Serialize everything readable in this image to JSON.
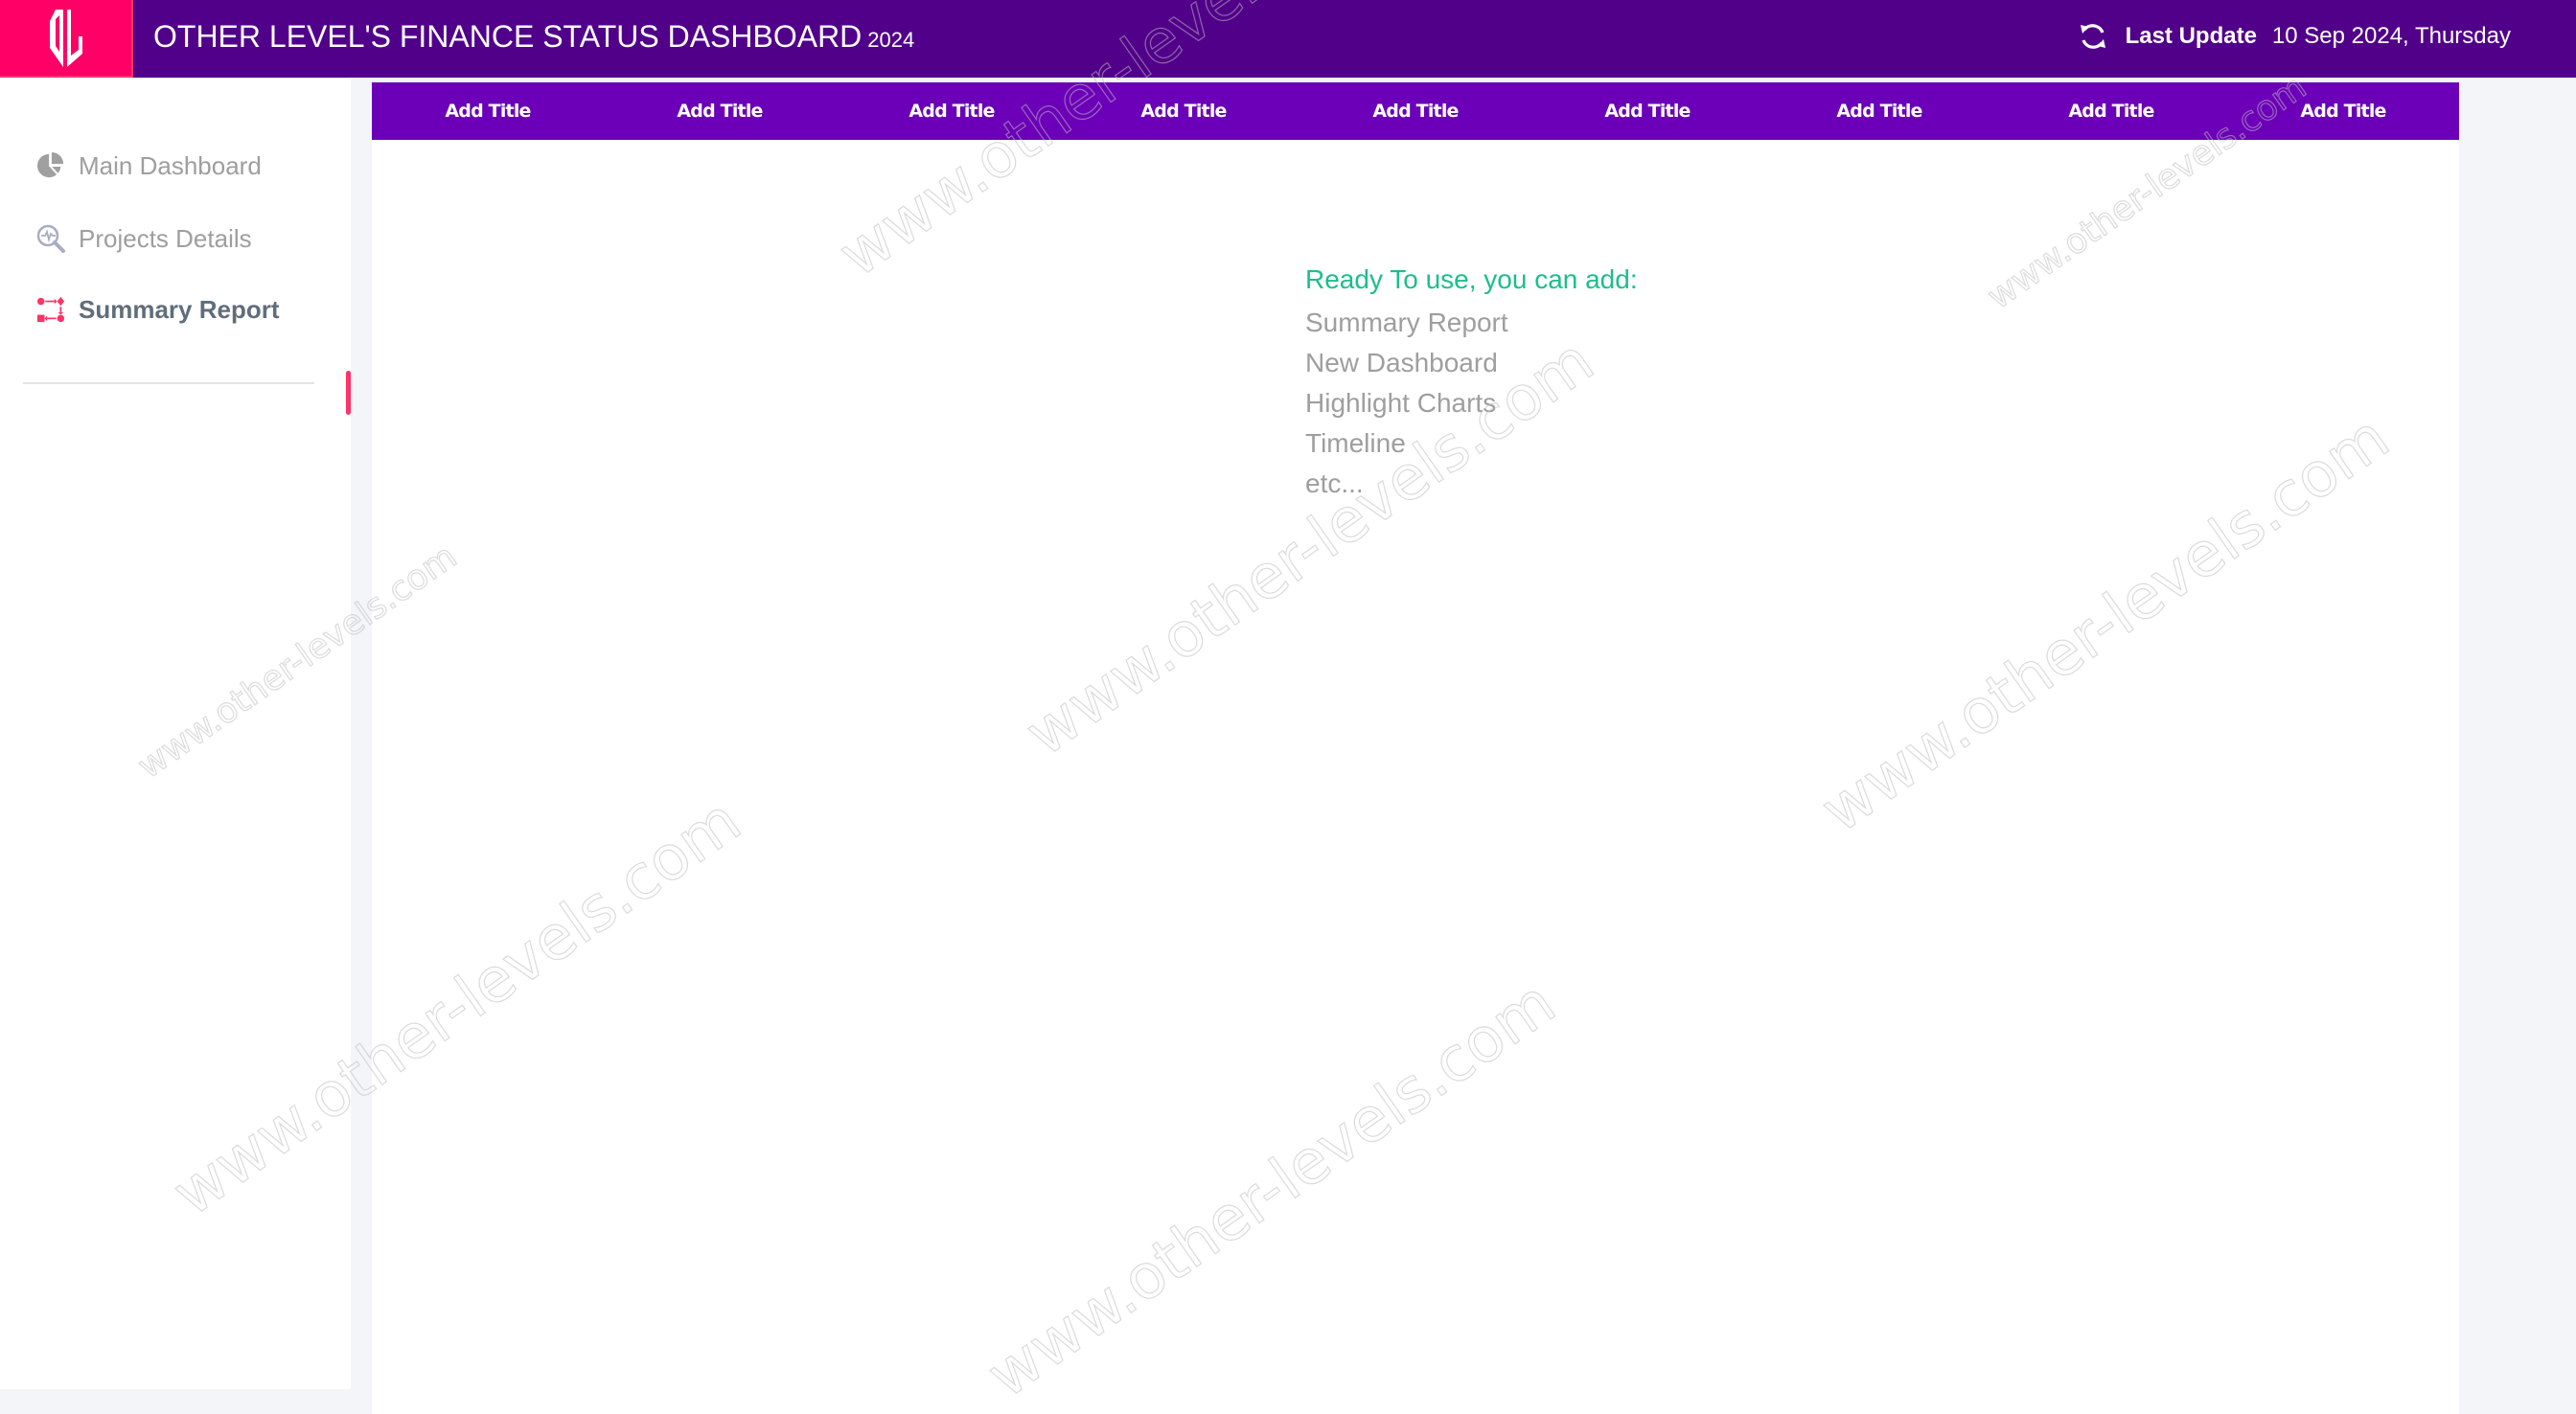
{
  "header": {
    "title": "OTHER LEVEL'S FINANCE STATUS DASHBOARD",
    "year": "2024",
    "logo": "OL",
    "last_update_label": "Last Update",
    "last_update_value": "10 Sep 2024, Thursday",
    "refresh_icon": "refresh-icon"
  },
  "sidebar": {
    "items": [
      {
        "label": "Main Dashboard",
        "icon": "pie-chart-icon",
        "active": false
      },
      {
        "label": "Projects Details",
        "icon": "search-analytics-icon",
        "active": false
      },
      {
        "label": "Summary Report",
        "icon": "workflow-icon",
        "active": true
      }
    ]
  },
  "main": {
    "title_bar": [
      "Add Title",
      "Add Title",
      "Add Title",
      "Add Title",
      "Add Title",
      "Add Title",
      "Add Title",
      "Add Title",
      "Add Title"
    ],
    "info_heading": "Ready To use, you can add:",
    "info_items": [
      "Summary Report",
      "New Dashboard",
      "Highlight Charts",
      "Timeline",
      "etc..."
    ]
  },
  "watermark": "www.other-levels.com",
  "colors": {
    "header_bg": "#51008A",
    "logo_bg": "#FF0066",
    "title_bar_bg": "#6B00B8",
    "accent_green": "#1DBE8A",
    "active_marker": "#FF3366",
    "page_bg": "#F4F5F9"
  }
}
